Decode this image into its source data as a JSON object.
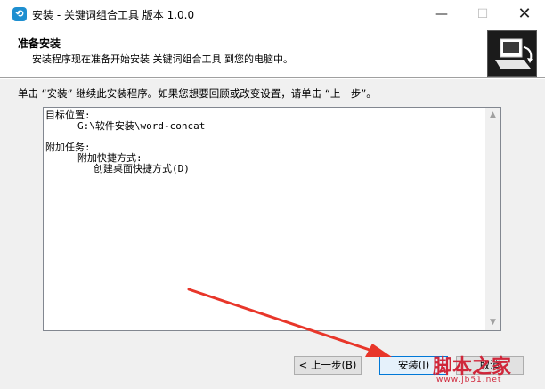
{
  "window": {
    "title": "安装 - 关键词组合工具 版本 1.0.0",
    "app_icon": "setup-icon",
    "minimize_glyph": "—",
    "maximize_glyph": "☐",
    "close_glyph": "✕"
  },
  "header": {
    "title": "准备安装",
    "subtitle": "安装程序现在准备开始安装 关键词组合工具 到您的电脑中。",
    "logo_icon": "installer-computer-icon"
  },
  "main": {
    "instruction": "单击 “安装” 继续此安装程序。如果您想要回顾或改变设置，请单击 “上一步”。",
    "memo_lines": [
      "目标位置:",
      "G:\\软件安装\\word-concat",
      "",
      "附加任务:",
      "附加快捷方式:",
      "创建桌面快捷方式(D)"
    ]
  },
  "buttons": {
    "back": "< 上一步(B)",
    "install": "安装(I)",
    "cancel": "取消"
  },
  "watermark": {
    "text": "脚本之家",
    "sub": "www.jb51.net"
  },
  "colors": {
    "accent": "#0078d7",
    "arrow": "#e8362a",
    "watermark": "#d0263a"
  }
}
